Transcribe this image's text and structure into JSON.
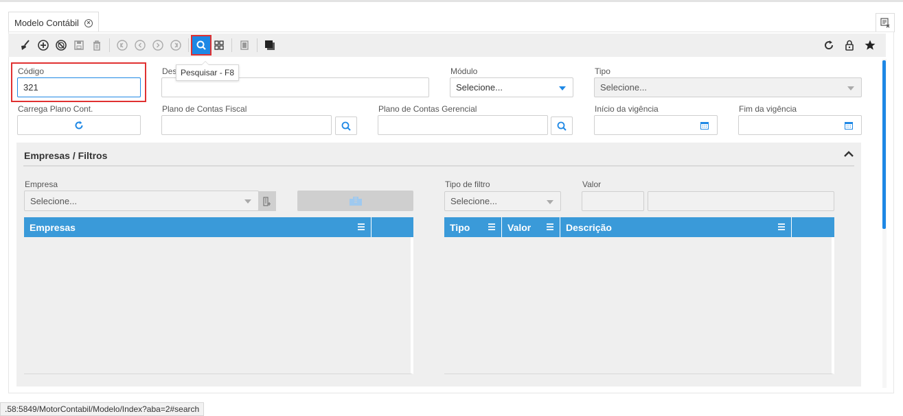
{
  "tab": {
    "label": "Modelo Contábil"
  },
  "toolbar": {
    "tooltip": "Pesquisar - F8"
  },
  "form": {
    "codigo": {
      "label": "Código",
      "value": "321"
    },
    "descricao": {
      "label": "Des",
      "value": ""
    },
    "modulo": {
      "label": "Módulo",
      "value": "Selecione..."
    },
    "tipo": {
      "label": "Tipo",
      "value": "Selecione..."
    },
    "carrega_plano": {
      "label": "Carrega Plano Cont."
    },
    "plano_fiscal": {
      "label": "Plano de Contas Fiscal",
      "value": ""
    },
    "plano_gerencial": {
      "label": "Plano de Contas Gerencial",
      "value": ""
    },
    "inicio_vigencia": {
      "label": "Início da vigência",
      "value": ""
    },
    "fim_vigencia": {
      "label": "Fim da vigência",
      "value": ""
    }
  },
  "section": {
    "title": "Empresas / Filtros",
    "empresa": {
      "label": "Empresa",
      "value": "Selecione..."
    },
    "tipo_filtro": {
      "label": "Tipo de filtro",
      "value": "Selecione..."
    },
    "valor": {
      "label": "Valor"
    },
    "grid_empresas": {
      "columns": [
        "Empresas"
      ]
    },
    "grid_filtros": {
      "columns": [
        "Tipo",
        "Valor",
        "Descrição"
      ]
    }
  },
  "status_url": ".58:5849/MotorContabil/Modelo/Index?aba=2#search",
  "colors": {
    "accent": "#1e88e5",
    "grid_header": "#3a9ad9",
    "highlight": "#e03030"
  },
  "icons": [
    "broom-icon",
    "plus-circle-icon",
    "cancel-circle-icon",
    "save-icon",
    "trash-icon",
    "first-icon",
    "prev-icon",
    "next-icon",
    "last-icon",
    "search-icon",
    "grid-icon",
    "copy-icon",
    "window-icon",
    "refresh-icon",
    "lock-icon",
    "star-icon",
    "calendar-icon",
    "building-icon",
    "chevron-up-icon",
    "menu-icon",
    "close-tabs-icon"
  ]
}
